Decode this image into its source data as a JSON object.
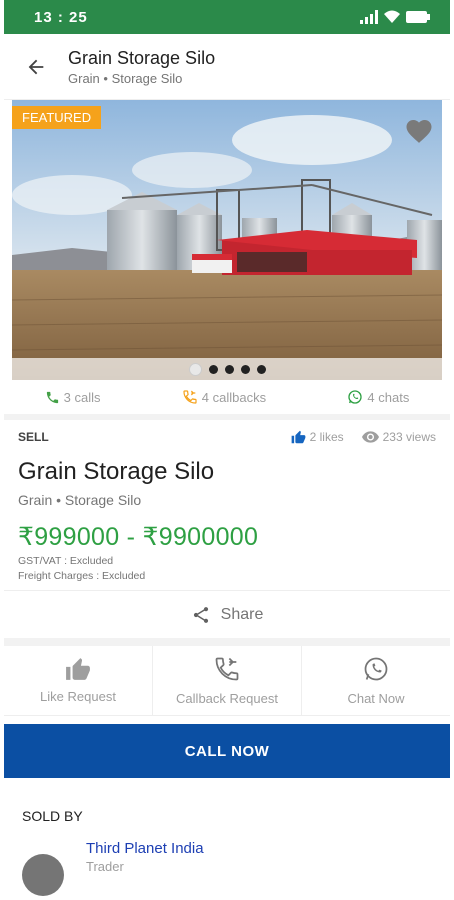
{
  "statusbar": {
    "time": "13 : 25"
  },
  "appbar": {
    "title": "Grain Storage Silo",
    "subtitle": "Grain • Storage Silo"
  },
  "gallery": {
    "badge": "FEATURED",
    "photo_count": 5,
    "active_index": 0
  },
  "stats": {
    "calls": "3 calls",
    "callbacks": "4 callbacks",
    "chats": "4 chats"
  },
  "listing": {
    "type": "SELL",
    "likes": "2 likes",
    "views": "233 views",
    "title": "Grain Storage Silo",
    "subtitle": "Grain • Storage Silo",
    "price": "₹999000 - ₹9900000",
    "gst": "GST/VAT : Excluded",
    "freight": "Freight Charges : Excluded"
  },
  "share_label": "Share",
  "actions": {
    "like": "Like Request",
    "callback": "Callback Request",
    "chat": "Chat Now"
  },
  "call_now": "CALL NOW",
  "sold_by": {
    "label": "SOLD BY",
    "name": "Third Planet India",
    "type": "Trader"
  },
  "colors": {
    "brand_green": "#2b8a4a",
    "price_green": "#2ea043",
    "call_blue": "#0b4fa3",
    "featured_orange": "#f5a21b"
  }
}
